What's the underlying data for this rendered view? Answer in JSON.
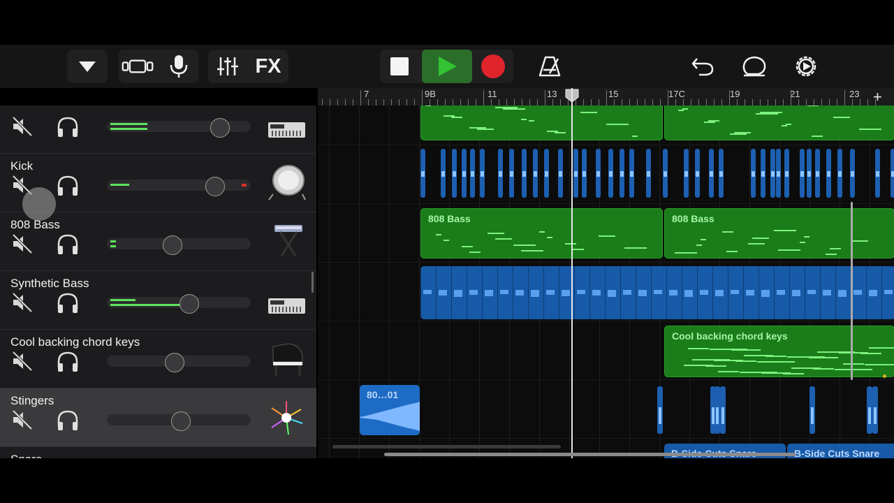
{
  "toolbar": {
    "fx_label": "FX"
  },
  "ruler": {
    "labels": [
      "7",
      "9B",
      "11",
      "13",
      "15",
      "17C",
      "19",
      "21",
      "23"
    ],
    "add_label": "+"
  },
  "tracks": [
    {
      "name": "",
      "instrument": "synth-keyboard-icon"
    },
    {
      "name": "Kick",
      "instrument": "kick-drum-icon"
    },
    {
      "name": "808 Bass",
      "instrument": "keyboard-stand-icon"
    },
    {
      "name": "Synthetic Bass",
      "instrument": "synth-keyboard-icon"
    },
    {
      "name": "Cool backing chord keys",
      "instrument": "grand-piano-icon"
    },
    {
      "name": "Stingers",
      "instrument": "sparkle-burst-icon"
    },
    {
      "name": "Snare",
      "instrument": "drumstick-icon"
    }
  ],
  "regions": {
    "bass_a": "808 Bass",
    "bass_b": "808 Bass",
    "keys": "Cool backing chord keys",
    "stinger": "80…01",
    "snare_a": "B-Side Cuts Snare",
    "snare_b": "B-Side Cuts Snare"
  },
  "colors": {
    "midi_region": "#1a7d1a",
    "audio_region": "#175aa8",
    "record": "#e0242c",
    "play": "#33c233",
    "meter": "#5ee65e"
  }
}
